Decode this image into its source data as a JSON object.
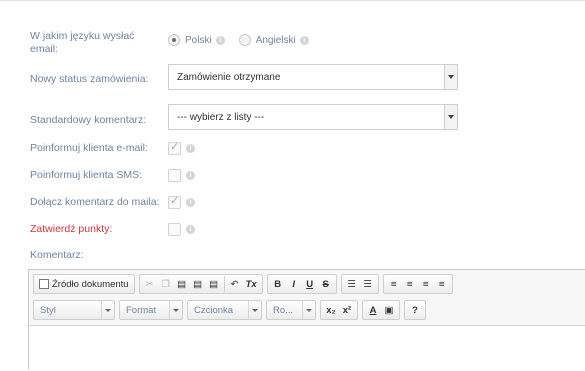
{
  "form": {
    "language_label": "W jakim języku wysłać email:",
    "language_options": [
      {
        "label": "Polski",
        "selected": true
      },
      {
        "label": "Angielski",
        "selected": false
      }
    ],
    "status_label": "Nowy status zamówienia:",
    "status_value": "Zamówienie otrzymane",
    "comment_label": "Standardowy komentarz:",
    "comment_value": "--- wybierz z listy ---",
    "notify_email_label": "Poinformuj klienta e-mail:",
    "notify_email_checked": true,
    "notify_sms_label": "Poinformuj klienta SMS:",
    "notify_sms_checked": false,
    "attach_comment_label": "Dołącz komentarz do maila:",
    "attach_comment_checked": true,
    "confirm_points_label": "Zatwierdź punkty:",
    "confirm_points_checked": false,
    "textarea_label": "Komentarz:",
    "info_glyph": "i"
  },
  "editor": {
    "source_label": "Źródło dokumentu",
    "style_combo": "Styl",
    "format_combo": "Format",
    "font_combo": "Czcionka",
    "size_combo": "Ro...",
    "help": "?",
    "bold": "B",
    "italic": "I",
    "underline": "U",
    "strike": "S",
    "sub": "x₂",
    "sup": "x²",
    "text_color": "A",
    "remove_format": "Tx"
  },
  "colors": {
    "label": "#6f84a0",
    "required_label": "#d3333a"
  }
}
